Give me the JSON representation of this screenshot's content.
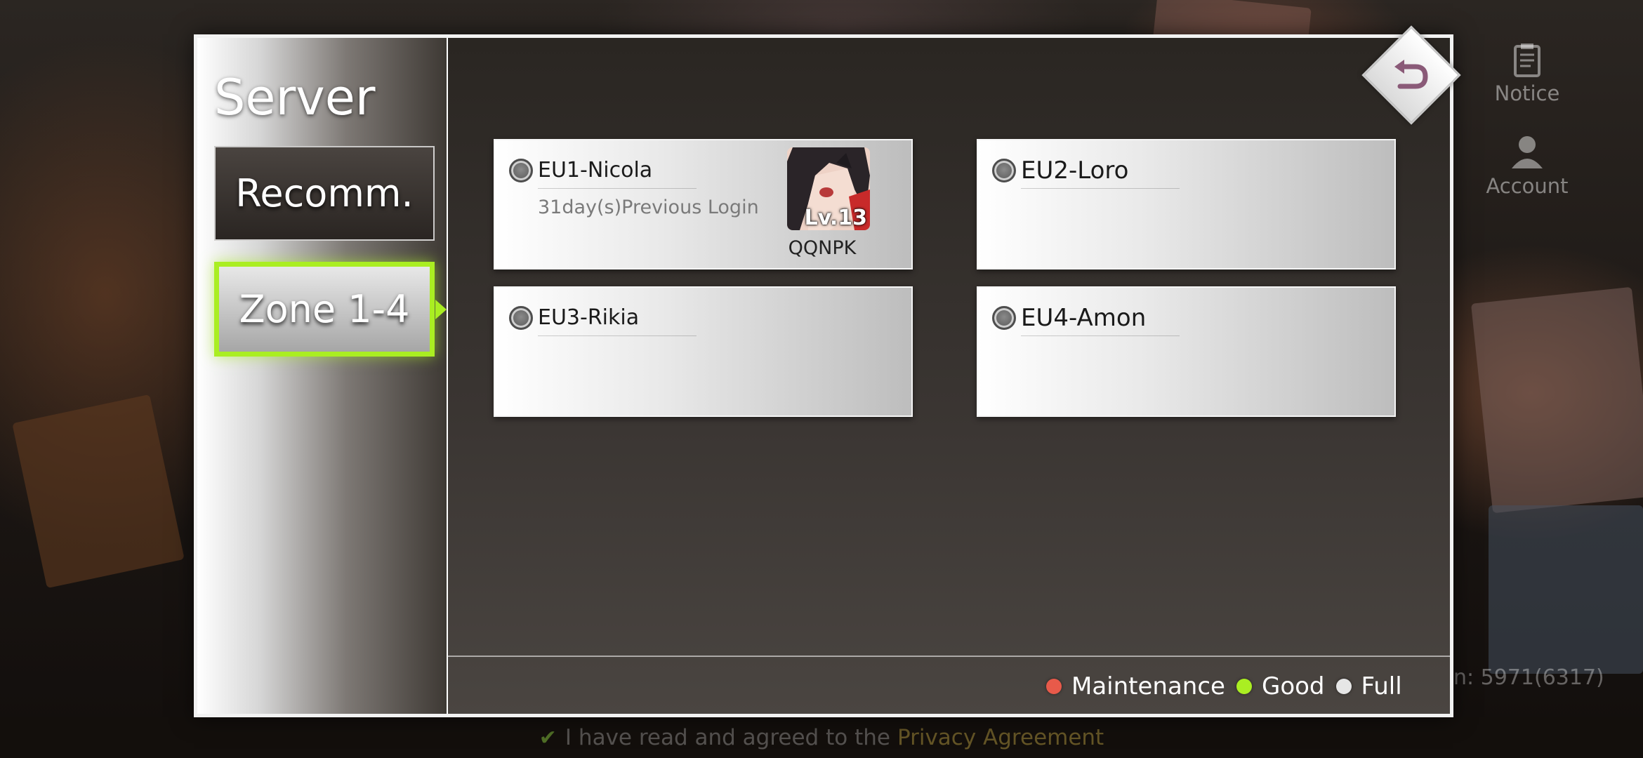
{
  "panel": {
    "title": "Server",
    "tabs": [
      {
        "label": "Recomm."
      },
      {
        "label": "Zone 1-4"
      }
    ]
  },
  "servers": [
    {
      "name": "EU1-Nicola",
      "last_login": "31day(s)Previous Login",
      "character": {
        "name": "QQNPK",
        "level": "Lv.13"
      }
    },
    {
      "name": "EU2-Loro"
    },
    {
      "name": "EU3-Rikia"
    },
    {
      "name": "EU4-Amon"
    }
  ],
  "legend": [
    {
      "label": "Maintenance",
      "color": "#e85a4a"
    },
    {
      "label": "Good",
      "color": "#aaee22"
    },
    {
      "label": "Full",
      "color": "#e6e6e6"
    }
  ],
  "side_menu": {
    "notice_label": "Notice",
    "account_label": "Account"
  },
  "online_count": "n: 5971(6317)",
  "privacy": {
    "text": "I have read and agreed to the",
    "link": "Privacy Agreement"
  }
}
